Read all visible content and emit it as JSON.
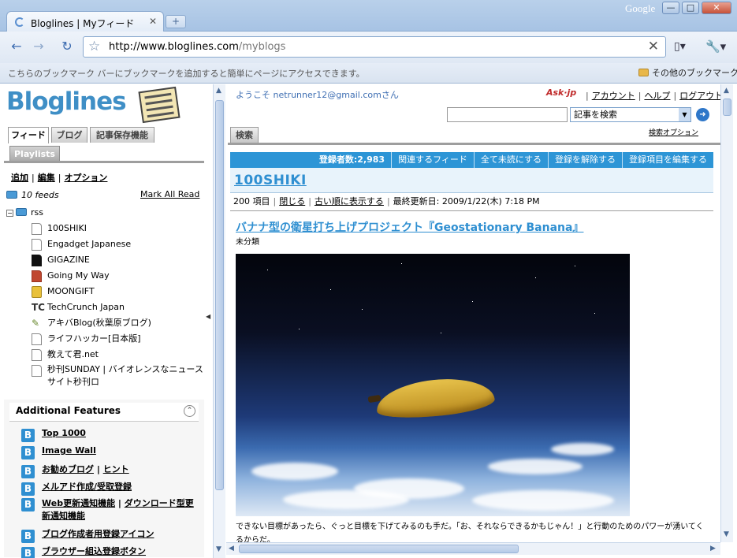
{
  "browser": {
    "tab_title": "Bloglines | Myフィード",
    "brand": "Google",
    "url_host": "http://www.bloglines.com",
    "url_path": "/myblogs",
    "bookmark_hint": "こちらのブックマーク バーにブックマークを追加すると簡単にページにアクセスできます。",
    "other_bookmarks": "その他のブックマーク"
  },
  "sidebar": {
    "logo": "Bloglines",
    "tabs": [
      "フィード",
      "ブログ",
      "記事保存機能"
    ],
    "playlists": "Playlists",
    "menu": [
      "追加",
      "編集",
      "オプション"
    ],
    "feed_count": "10 feeds",
    "mark_all_read": "Mark All Read",
    "folder": "rss",
    "feeds": [
      {
        "name": "100SHIKI",
        "icon": "page-icon"
      },
      {
        "name": "Engadget Japanese",
        "icon": "page-icon"
      },
      {
        "name": "GIGAZINE",
        "icon": "gigazine-icon"
      },
      {
        "name": "Going My Way",
        "icon": "goingmyway-icon"
      },
      {
        "name": "MOONGIFT",
        "icon": "moongift-icon"
      },
      {
        "name": "TechCrunch Japan",
        "icon": "techcrunch-icon"
      },
      {
        "name": "アキバBlog(秋葉原ブログ)",
        "icon": "akiba-icon"
      },
      {
        "name": "ライフハッカー[日本版]",
        "icon": "page-icon"
      },
      {
        "name": "教えて君.net",
        "icon": "page-icon"
      },
      {
        "name": "秒刊SUNDAY | バイオレンスなニュースサイト秒刊ロ",
        "icon": "page-icon"
      }
    ],
    "additional_features": {
      "title": "Additional Features",
      "items": [
        {
          "label": "Top 1000"
        },
        {
          "label": "Image Wall"
        },
        {
          "label": "お勧めブログ",
          "extra": "ヒント"
        },
        {
          "label": "メルアド作成/受取登録"
        },
        {
          "label": "Web更新通知機能",
          "extra": "ダウンロード型更新通知機能"
        },
        {
          "label": "ブログ作成者用登録アイコン"
        },
        {
          "label": "ブラウザー組込登録ボタン"
        }
      ]
    }
  },
  "header": {
    "welcome": "ようこそ netrunner12@gmail.comさん",
    "ask": "Ask·jp",
    "links": [
      "アカウント",
      "ヘルプ",
      "ログアウト"
    ],
    "search_value": "",
    "search_scope": "記事を検索",
    "search_options": "検索オプション",
    "search_tab": "検索"
  },
  "feed": {
    "stats": [
      "登録者数:2,983",
      "関連するフィード",
      "全て未読にする",
      "登録を解除する",
      "登録項目を編集する"
    ],
    "title": "100SHIKI",
    "count": "200 項目",
    "close": "閉じる",
    "order": "古い順に表示する",
    "updated": "最終更新日: 2009/1/22(木) 7:18 PM"
  },
  "article": {
    "title": "バナナ型の衛星打ち上げプロジェクト『Geostationary Banana』",
    "category": "未分類",
    "body": "できない目標があったら、ぐっと目標を下げてみるのも手だ。「お、それならできるかもじゃん！」と行動のためのパワーが湧いてくるからだ。"
  }
}
